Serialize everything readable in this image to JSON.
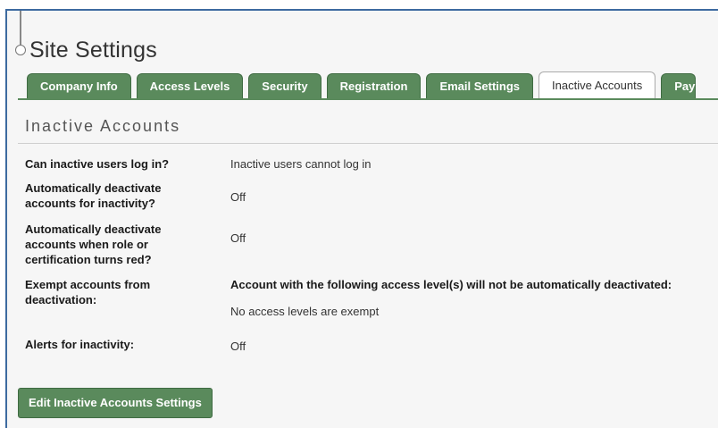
{
  "page": {
    "title": "Site Settings"
  },
  "tabs": [
    {
      "label": "Company Info"
    },
    {
      "label": "Access Levels"
    },
    {
      "label": "Security"
    },
    {
      "label": "Registration"
    },
    {
      "label": "Email Settings"
    },
    {
      "label": "Inactive Accounts",
      "active": true
    },
    {
      "label": "Pay"
    }
  ],
  "section": {
    "title": "Inactive Accounts"
  },
  "settings": {
    "login": {
      "label": "Can inactive users log in?",
      "value": "Inactive users cannot log in"
    },
    "auto_deactivate": {
      "label": "Automatically deactivate accounts for inactivity?",
      "value": "Off"
    },
    "role_red": {
      "label": "Automatically deactivate accounts when role or certification turns red?",
      "value": "Off"
    },
    "exempt": {
      "label": "Exempt accounts from deactivation:",
      "heading": "Account with the following access level(s) will not be automatically deactivated:",
      "value": "No access levels are exempt"
    },
    "alerts": {
      "label": "Alerts for inactivity:",
      "value": "Off"
    }
  },
  "actions": {
    "edit_label": "Edit Inactive Accounts Settings"
  },
  "colors": {
    "tab_green": "#5a8a5c",
    "frame_border": "#3d6aa0"
  }
}
